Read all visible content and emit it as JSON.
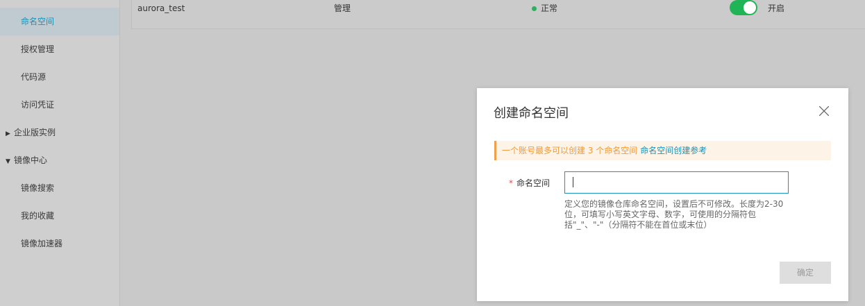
{
  "sidebar": {
    "items": [
      {
        "label": "命名空间",
        "active": true
      },
      {
        "label": "授权管理"
      },
      {
        "label": "代码源"
      },
      {
        "label": "访问凭证"
      }
    ],
    "groups": [
      {
        "label": "企业版实例",
        "caret": "▶"
      },
      {
        "label": "镜像中心",
        "caret": "▼"
      }
    ],
    "subitems": [
      {
        "label": "镜像搜索"
      },
      {
        "label": "我的收藏"
      },
      {
        "label": "镜像加速器"
      }
    ]
  },
  "table": {
    "row": {
      "name": "aurora_test",
      "type": "管理",
      "status": "正常",
      "status_color": "#27b35b",
      "toggle_label": "开启",
      "toggle_on": true
    }
  },
  "dialog": {
    "title": "创建命名空间",
    "notice_text": "一个账号最多可以创建 3 个命名空间",
    "notice_link": "命名空间创建参考",
    "field_required_mark": "*",
    "field_label": "命名空间",
    "field_value": "",
    "hint": "定义您的镜像仓库命名空间，设置后不可修改。长度为2-30位，可填写小写英文字母、数字，可使用的分隔符包括\"_\"、\"-\"（分隔符不能在首位或末位）",
    "confirm_label": "确定"
  },
  "colors": {
    "accent": "#1a91b6",
    "warning": "#f29a3a",
    "toggle": "#1fb556"
  }
}
